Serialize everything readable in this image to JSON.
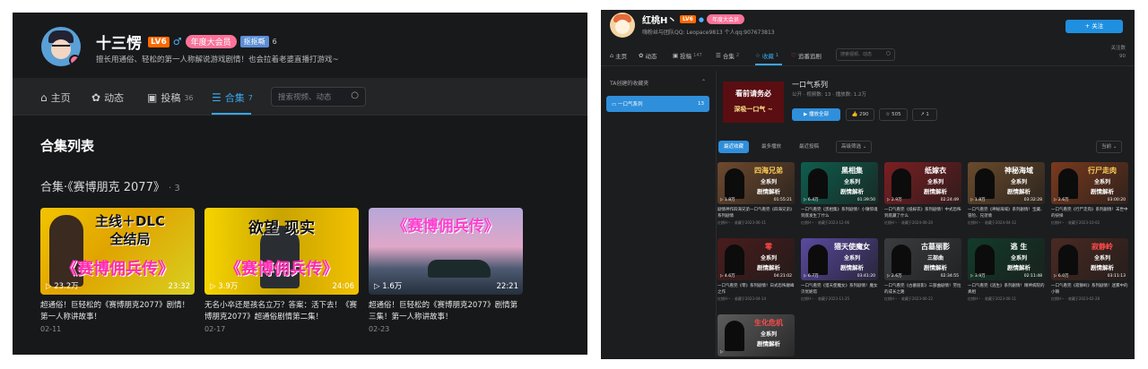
{
  "left": {
    "profile": {
      "name": "十三愣",
      "level": "LV6",
      "gender_symbol": "♂",
      "vip_tag": "年度大会员",
      "medal": "抠抠嘶",
      "medal_count": "6",
      "sign": "擅长用通俗、轻松的第一人称解说游戏剧情！也会拉着老婆直播打游戏~"
    },
    "nav": {
      "items": [
        {
          "label": "主页",
          "icon": "home-icon",
          "count": ""
        },
        {
          "label": "动态",
          "icon": "dynamic-icon",
          "count": ""
        },
        {
          "label": "投稿",
          "icon": "tv-icon",
          "count": "36"
        },
        {
          "label": "合集",
          "icon": "stack-icon",
          "count": "7"
        }
      ],
      "active": "合集",
      "search_placeholder": "搜索视频、动态"
    },
    "section_title": "合集列表",
    "collection": {
      "title": "合集·《赛博朋克 2077》",
      "count": "· 3"
    },
    "cards": [
      {
        "thumb_line1": "主线＋DLC",
        "thumb_line2": "全结局",
        "thumb_line3": "《赛博佣兵传》",
        "views": "23.2万",
        "duration": "23:32",
        "title": "超通俗！巨轻松的《赛博朋克2077》剧情！第一人称讲故事！",
        "date": "02-11"
      },
      {
        "thumb_line1": "欲望  现实",
        "thumb_line2": "",
        "thumb_line3": "《赛博佣兵传》",
        "views": "3.9万",
        "duration": "24:06",
        "title": "无名小卒还是孩名立万？答案：活下去！《赛博朋克2077》超通俗剧情第二集！",
        "date": "02-17"
      },
      {
        "thumb_line1": "《赛博佣兵传》",
        "thumb_line2": "",
        "thumb_line3": "",
        "views": "1.6万",
        "duration": "22:21",
        "title": "超通俗！巨轻松的《赛博朋克2077》剧情第三集！第一人称讲故事！",
        "date": "02-23"
      }
    ]
  },
  "right": {
    "profile": {
      "name": "红桃H丶",
      "level": "LV6",
      "vip_tag": "年度大会员",
      "sign": "嗨粉丝与团队QQ: Leopace9813 个人qq:907673813",
      "follow_label": "+ 关注"
    },
    "nav": {
      "items": [
        {
          "label": "主页",
          "count": ""
        },
        {
          "label": "动态",
          "count": ""
        },
        {
          "label": "投稿",
          "count": "147"
        },
        {
          "label": "合集",
          "count": "2"
        },
        {
          "label": "收藏",
          "count": "1"
        },
        {
          "label": "追番追剧",
          "count": ""
        }
      ],
      "active": "收藏",
      "search_placeholder": "搜索视频、动态",
      "stat_label": "关注数",
      "stat_value": "90"
    },
    "sidebar": {
      "header": "TA创建的收藏夹",
      "folder_name": "一口气系列",
      "folder_count": "13"
    },
    "folder": {
      "cover_line1": "看前请务必",
      "cover_line2": "深吸一口气 ~",
      "title": "一口气系列",
      "meta": "公开 · 视频数: 13 · 播放数: 1.2万",
      "play_label": "▶ 播放全部",
      "like": "👍 290",
      "fav": "☆ 505",
      "share": "↗ 1"
    },
    "sort": {
      "options": [
        "最近收藏",
        "最多播放",
        "最近投稿",
        "高级筛选 ⌄"
      ],
      "active": "最近收藏",
      "right_dropdown": "当前 ⌄"
    },
    "cards": [
      {
        "t1": "四海兄弟",
        "t2": "全系列",
        "t3": "剧情解析",
        "color": "#6e4a2e",
        "accent": "#ffcf56",
        "views": "1.8万",
        "duration": "01:55:21",
        "title": "剧情神作四海兄弟一口气看完《四海兄弟》系列剧情",
        "meta": "红桃H丶 · 收藏于2023-06-11"
      },
      {
        "t1": "黑相集",
        "t2": "全系列",
        "t3": "剧情解析",
        "color": "#0e5e4e",
        "accent": "#ffffff",
        "views": "6.4万",
        "duration": "01:39:50",
        "title": "一口气看完《黑相集》系列剧情！小镇惊魂到底发生了什么",
        "meta": "红桃H丶 · 收藏于2023-12-06"
      },
      {
        "t1": "纸嫁衣",
        "t2": "全系列",
        "t3": "剧情解析",
        "color": "#7b1f22",
        "accent": "#ffffff",
        "views": "2.9万",
        "duration": "02:24:49",
        "title": "一口气看完《纸嫁衣》系列剧情！中式恐怖到底藏了什么",
        "meta": "红桃H丶 · 收藏于2024-06-20"
      },
      {
        "t1": "神秘海域",
        "t2": "全系列",
        "t3": "剧情解析",
        "color": "#6a4b2c",
        "accent": "#ffffff",
        "views": "1.8万",
        "duration": "03:32:28",
        "title": "一口气看完《神秘海域》系列剧情！宝藏、冒险、兄弟情",
        "meta": "红桃H丶 · 收藏于2024-04-12"
      },
      {
        "t1": "行尸走肉",
        "t2": "全系列",
        "t3": "剧情解析",
        "color": "#7a3a1e",
        "accent": "#ffd35a",
        "views": "2.6万",
        "duration": "03:00:20",
        "title": "一口气看完《行尸走肉》系列剧情！末世中的抉择",
        "meta": "红桃H丶 · 收藏于2023-10-02"
      },
      {
        "t1": "零",
        "t2": "全系列",
        "t3": "剧情解析",
        "color": "#4a1c1c",
        "accent": "#ff4a4a",
        "views": "4.6万",
        "duration": "04:21:02",
        "title": "一口气看完《零》系列剧情！日式恐怖巅峰之作",
        "meta": "红桃H丶 · 收藏于2023-04-14"
      },
      {
        "t1": "猎天使魔女",
        "t2": "全系列",
        "t3": "剧情解析",
        "color": "#5a4aa0",
        "accent": "#ffffff",
        "views": "6.7万",
        "duration": "03:41:20",
        "title": "一口气看完《猎天使魔女》系列剧情！魔女贝优妮塔",
        "meta": "红桃H丶 · 收藏于2023-11-25"
      },
      {
        "t1": "古墓丽影",
        "t2": "三部曲",
        "t3": "剧情解析",
        "color": "#3a3d40",
        "accent": "#ffffff",
        "views": "2.6万",
        "duration": "02:34:55",
        "title": "一口气看完《古墓丽影》三部曲剧情！劳拉的成长之路",
        "meta": "红桃H丶 · 收藏于2023-06-22"
      },
      {
        "t1": "逃 生",
        "t2": "全系列",
        "t3": "剧情解析",
        "color": "#123b2a",
        "accent": "#ffffff",
        "views": "3.9万",
        "duration": "02:11:48",
        "title": "一口气看完《逃生》系列剧情！精神病院的真相",
        "meta": "红桃H丶 · 收藏于2023-06-11"
      },
      {
        "t1": "寂静岭",
        "t2": "全系列",
        "t3": "剧情解析",
        "color": "#4a2a22",
        "accent": "#ff4a4a",
        "views": "6.0万",
        "duration": "03:11:13",
        "title": "一口气看完《寂静岭》系列剧情！迷雾中的小镇",
        "meta": "红桃H丶 · 收藏于2023-02-28"
      },
      {
        "t1": "生化危机",
        "t2": "全系列",
        "t3": "剧情解析",
        "color": "#5c5c5c",
        "accent": "#ff4a4a",
        "views": "",
        "duration": "",
        "title": "",
        "meta": ""
      }
    ]
  }
}
